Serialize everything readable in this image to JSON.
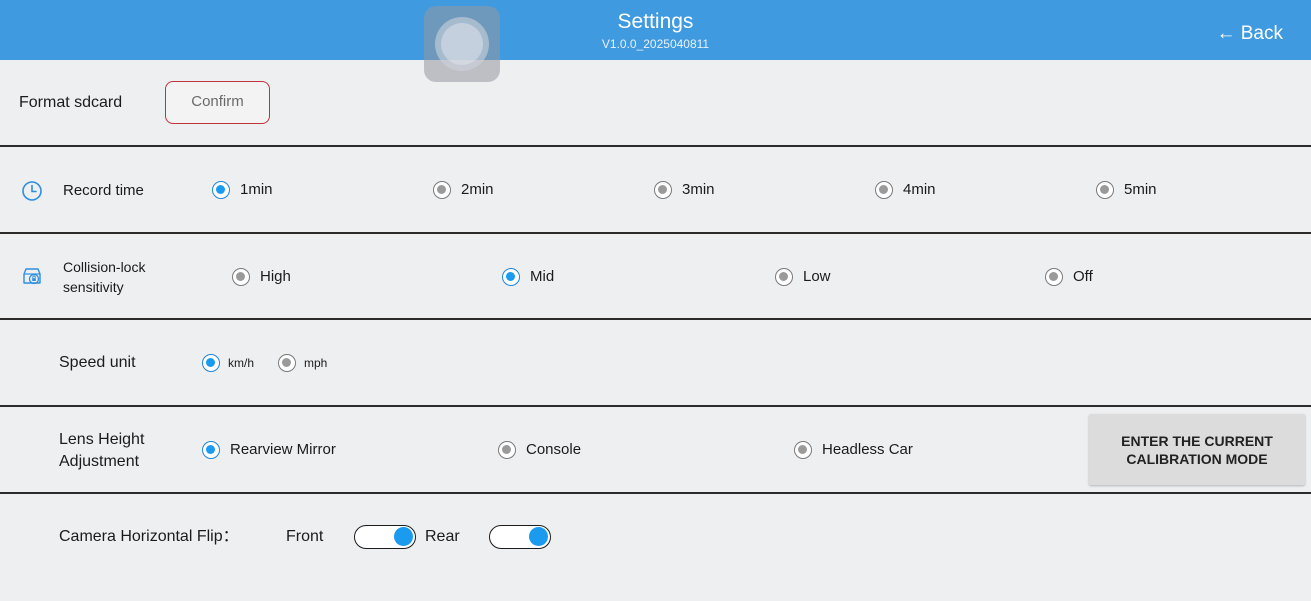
{
  "header": {
    "title": "Settings",
    "version": "V1.0.0_2025040811",
    "back_label": "← Back",
    "color": "#3f9ae0"
  },
  "format": {
    "label": "Format sdcard",
    "confirm_label": "Confirm"
  },
  "record_time": {
    "label": "Record time",
    "icon": "clock-icon",
    "options": [
      "1min",
      "2min",
      "3min",
      "4min",
      "5min"
    ],
    "selected": "1min"
  },
  "collision": {
    "label_line1": "Collision-lock",
    "label_line2": "sensitivity",
    "icon": "car-lock-icon",
    "options": [
      "High",
      "Mid",
      "Low",
      "Off"
    ],
    "selected": "Mid"
  },
  "speed_unit": {
    "label": "Speed unit",
    "options": [
      "km/h",
      "mph"
    ],
    "selected": "km/h"
  },
  "lens": {
    "label_line1": "Lens Height",
    "label_line2": "Adjustment",
    "options": [
      "Rearview Mirror",
      "Console",
      "Headless Car"
    ],
    "selected": "Rearview Mirror",
    "calibration_line1": "ENTER THE CURRENT",
    "calibration_line2": "CALIBRATION MODE"
  },
  "flip": {
    "label": "Camera Horizontal Flip：",
    "front_label": "Front",
    "rear_label": "Rear",
    "front_on": true,
    "rear_on": true
  },
  "accent_color": "#1a9bf0"
}
